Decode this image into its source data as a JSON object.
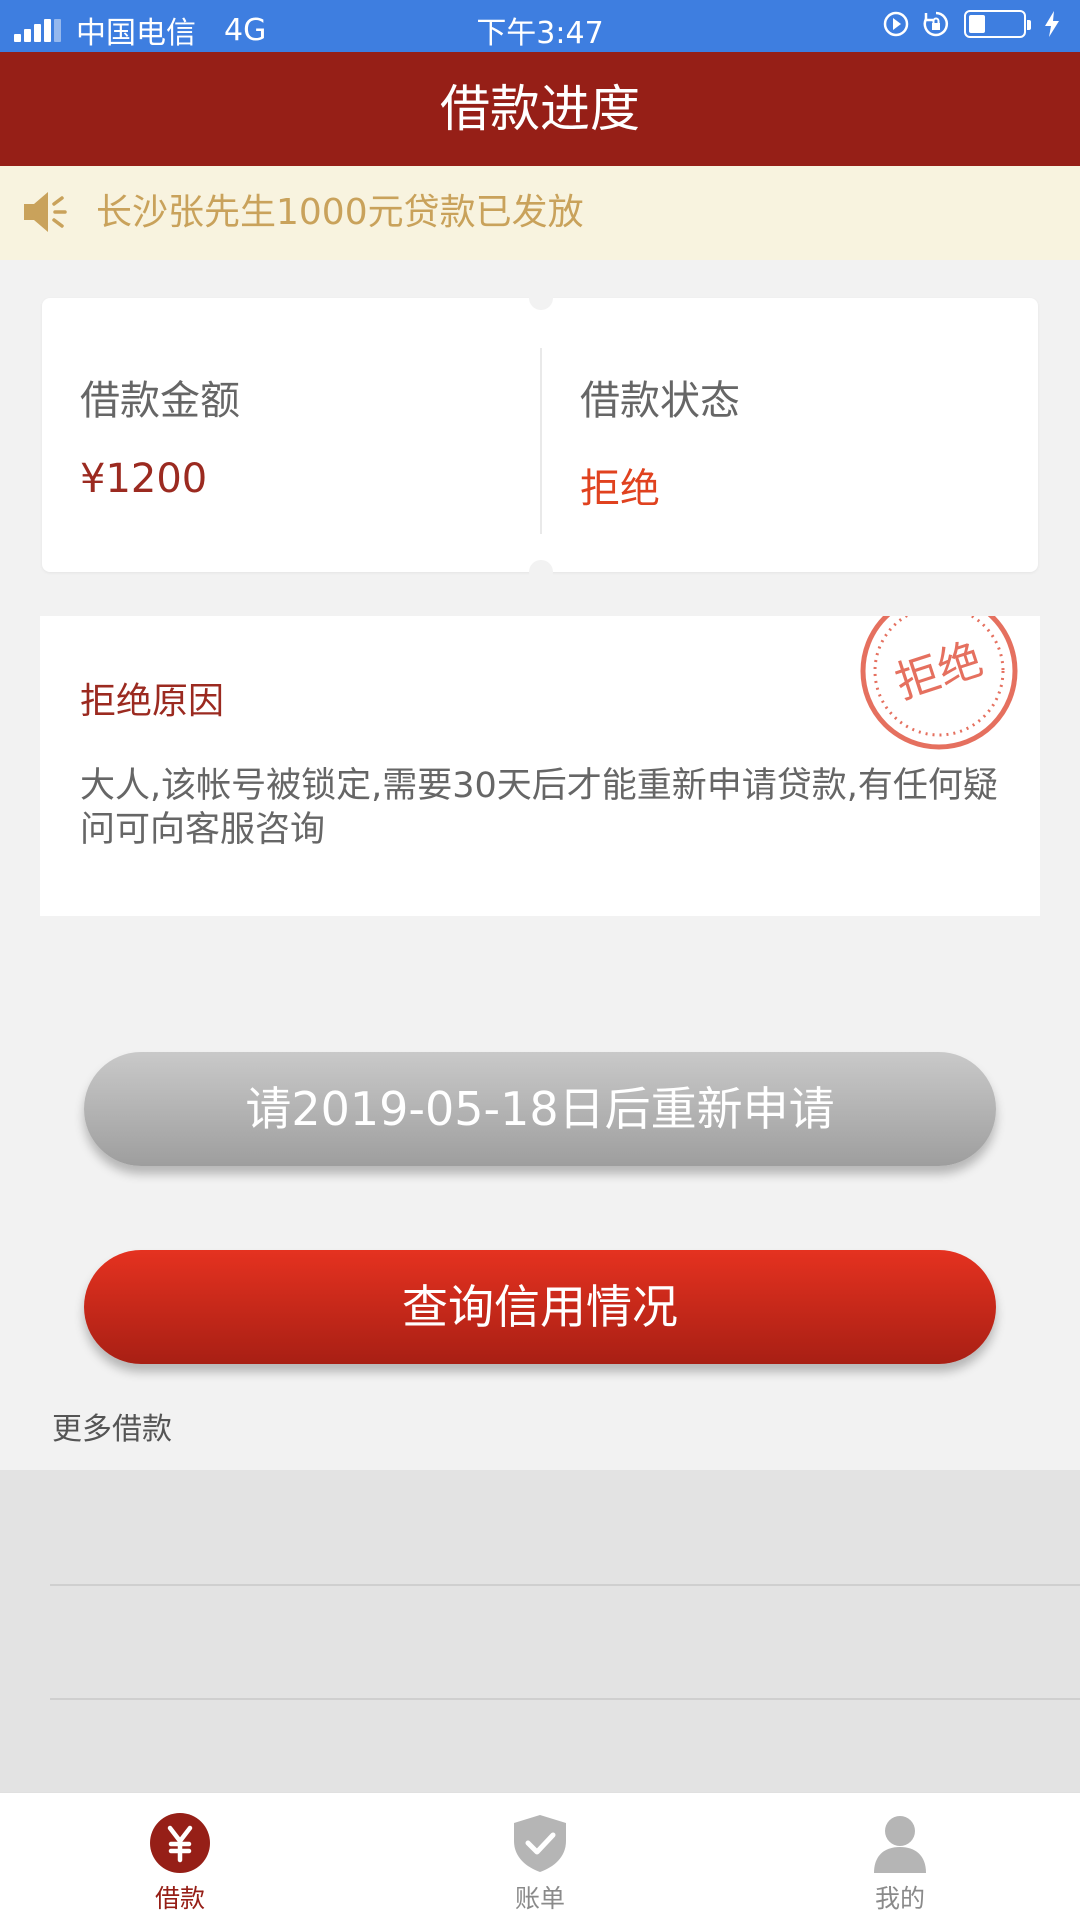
{
  "status_bar": {
    "carrier": "中国电信",
    "network": "4G",
    "time": "下午3:47",
    "battery_level": 0.3
  },
  "header": {
    "title": "借款进度"
  },
  "notice": {
    "text": "长沙张先生1000元贷款已发放",
    "icon": "speaker-icon"
  },
  "loan_summary": {
    "amount_label": "借款金额",
    "amount_value": "¥1200",
    "status_label": "借款状态",
    "status_value": "拒绝"
  },
  "rejection": {
    "title": "拒绝原因",
    "reason": "大人,该帐号被锁定,需要30天后才能重新申请贷款,有任何疑问可向客服咨询",
    "stamp_text": "拒绝"
  },
  "actions": {
    "reapply_label": "请2019-05-18日后重新申请",
    "credit_label": "查询信用情况"
  },
  "more_loans_label": "更多借款",
  "tabs": [
    {
      "label": "借款",
      "icon": "yen-icon",
      "active": true
    },
    {
      "label": "账单",
      "icon": "shield-check-icon",
      "active": false
    },
    {
      "label": "我的",
      "icon": "person-icon",
      "active": false
    }
  ],
  "colors": {
    "header_bg": "#961f17",
    "status_bar_bg": "#3e7ee0",
    "accent_red": "#e0421f",
    "notice_text": "#c9a25b"
  }
}
